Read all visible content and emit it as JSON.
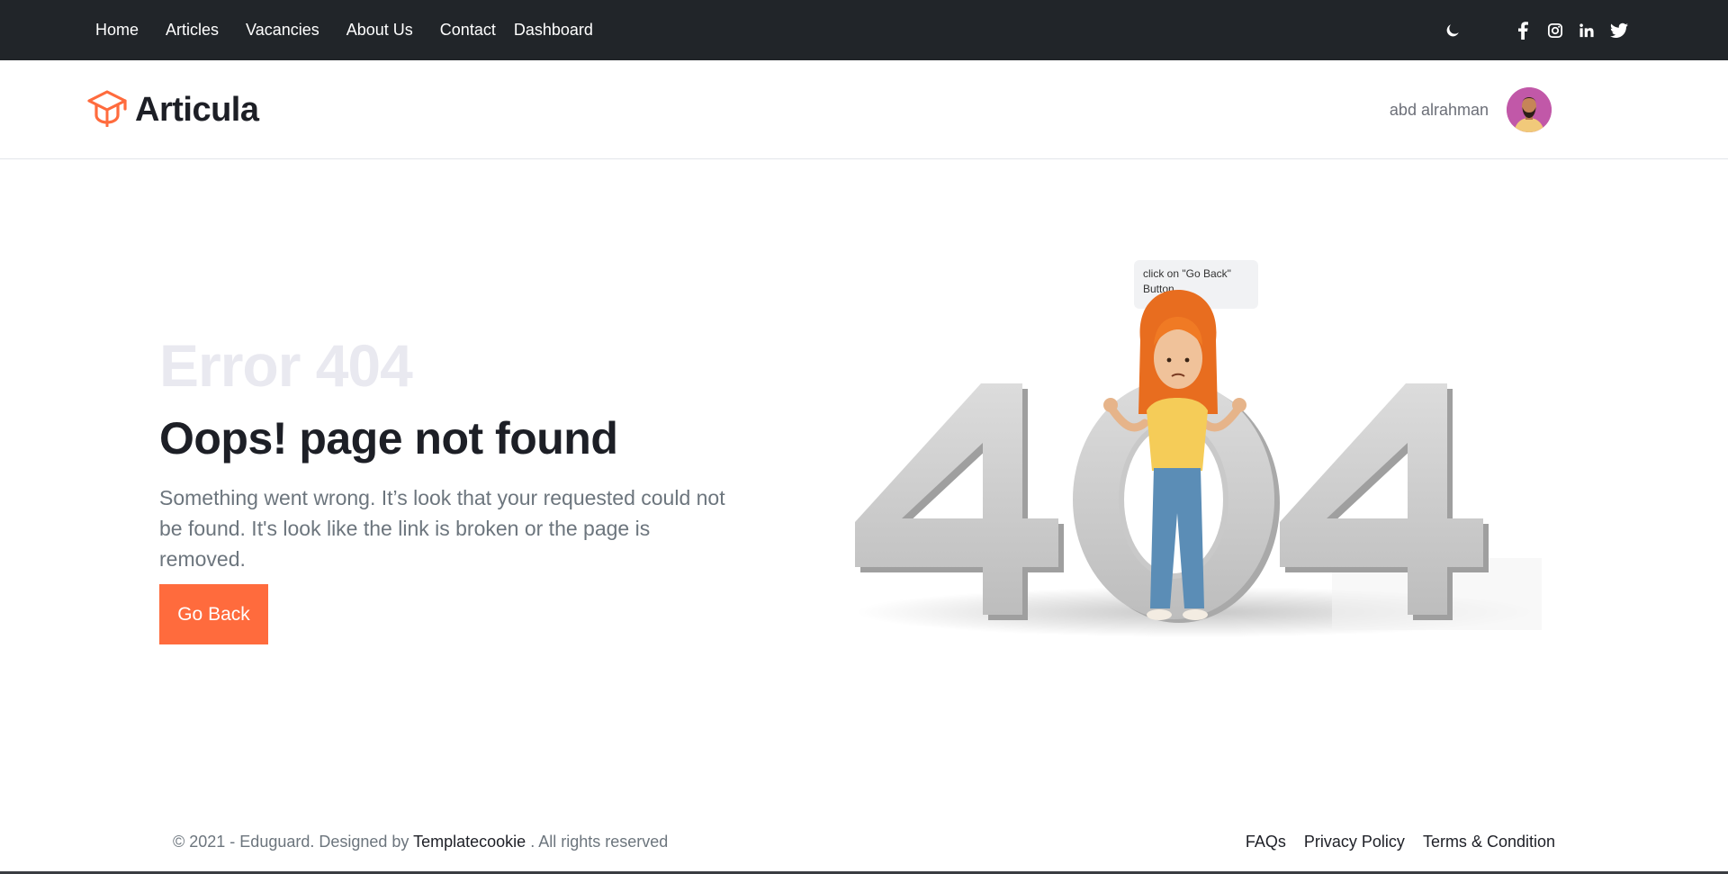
{
  "nav": {
    "items": [
      {
        "label": "Home"
      },
      {
        "label": "Articles"
      },
      {
        "label": "Vacancies"
      },
      {
        "label": "About Us"
      },
      {
        "label": "Contact"
      },
      {
        "label": "Dashboard"
      }
    ],
    "icons": [
      "moon-icon",
      "facebook-icon",
      "instagram-icon",
      "linkedin-icon",
      "twitter-icon"
    ]
  },
  "header": {
    "logo_text": "Articula",
    "logo_icon": "graduation-cap-icon",
    "user_name": "abd alrahman"
  },
  "main": {
    "error_code": "Error 404",
    "headline": "Oops! page not found",
    "description": "Something went wrong. It’s look that your requested could not be found. It's look like the link is broken or the page is removed.",
    "button_label": "Go Back",
    "bubble_text": "click on \"Go Back\" Button."
  },
  "footer": {
    "copy_prefix": "© 2021 - Eduguard. Designed by",
    "copy_link": "Templatecookie",
    "copy_suffix": ". All rights reserved",
    "links": [
      {
        "label": "FAQs"
      },
      {
        "label": "Privacy Policy"
      },
      {
        "label": "Terms & Condition"
      }
    ]
  },
  "colors": {
    "topbar": "#212529",
    "accent": "#ff6b3d",
    "text_dark": "#1d1f26",
    "text_muted": "#6c757d",
    "error_code": "#e9e9f0"
  }
}
